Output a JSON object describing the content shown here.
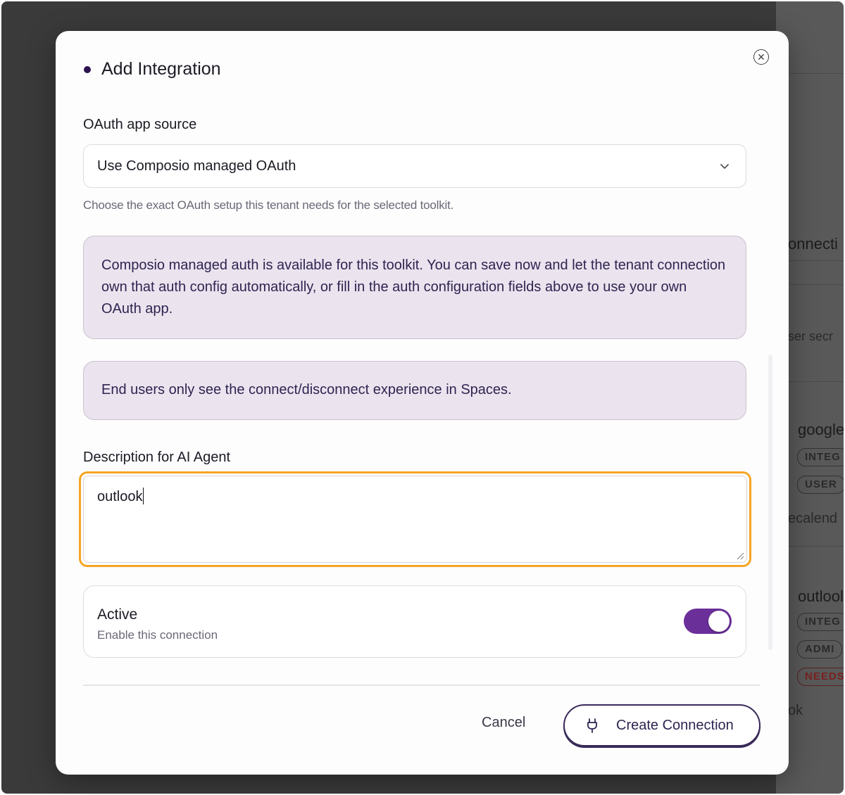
{
  "background": {
    "snippets": [
      "onnecti",
      "ser secr",
      "google",
      "ecalend",
      "outlool",
      "ok"
    ],
    "chips": [
      {
        "label": "INTEG",
        "color": "#2a2a2a"
      },
      {
        "label": "USER",
        "color": "#2a2a2a"
      },
      {
        "label": "INTEG",
        "color": "#2a2a2a"
      },
      {
        "label": "ADMI",
        "color": "#2a2a2a"
      },
      {
        "label": "NEEDS",
        "color": "#7a2020"
      }
    ]
  },
  "modal": {
    "title": "Add Integration",
    "close_icon": "close-circle-icon",
    "oauth_source": {
      "label": "OAuth app source",
      "selected": "Use Composio managed OAuth",
      "helper": "Choose the exact OAuth setup this tenant needs for the selected toolkit."
    },
    "info_managed": "Composio managed auth is available for this toolkit. You can save now and let the tenant connection own that auth config automatically, or fill in the auth configuration fields above to use your own OAuth app.",
    "info_spaces": "End users only see the connect/disconnect experience in Spaces.",
    "description": {
      "label": "Description for AI Agent",
      "value": "outlook"
    },
    "active": {
      "title": "Active",
      "subtitle": "Enable this connection",
      "enabled": true
    },
    "footer": {
      "cancel_label": "Cancel",
      "create_label": "Create Connection",
      "create_icon": "plug-icon"
    },
    "colors": {
      "accent": "#6b2f9a",
      "focus_ring": "#f5a524",
      "info_bg": "#ebe4ef"
    }
  }
}
